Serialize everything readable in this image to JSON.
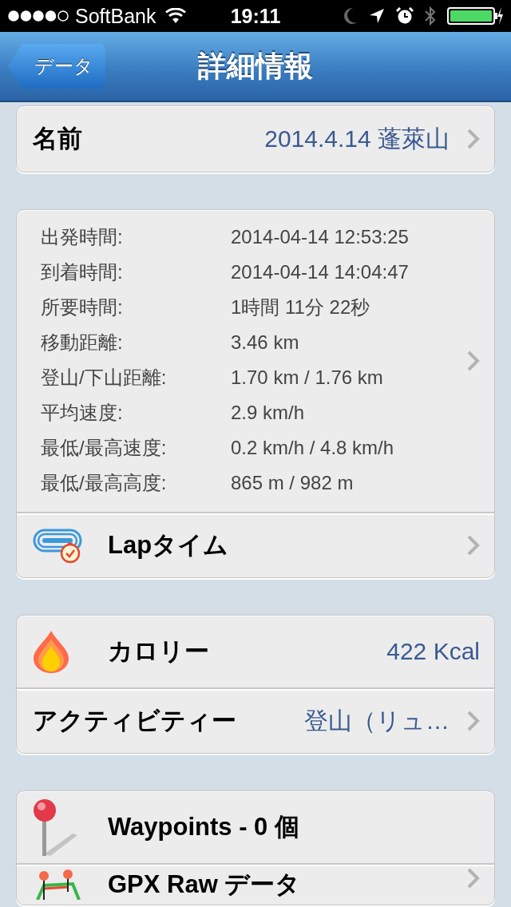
{
  "status_bar": {
    "carrier": "SoftBank",
    "time": "19:11"
  },
  "nav_bar": {
    "back_button": "データ",
    "title": "詳細情報"
  },
  "sections": [
    {
      "rows": [
        {
          "kind": "value",
          "label": "名前",
          "value": "2014.4.14 蓬萊山",
          "disclosure": true
        }
      ]
    },
    {
      "rows": [
        {
          "kind": "stats",
          "disclosure": true,
          "items": [
            {
              "label": "出発時間:",
              "value": "2014-04-14 12:53:25"
            },
            {
              "label": "到着時間:",
              "value": "2014-04-14 14:04:47"
            },
            {
              "label": "所要時間:",
              "value": "1時間 11分 22秒"
            },
            {
              "label": "移動距離:",
              "value": "3.46 km"
            },
            {
              "label": "登山/下山距離:",
              "value": "1.70 km / 1.76 km"
            },
            {
              "label": "平均速度:",
              "value": "2.9 km/h"
            },
            {
              "label": "最低/最高速度:",
              "value": "0.2 km/h / 4.8 km/h"
            },
            {
              "label": "最低/最高高度:",
              "value": "865 m / 982 m"
            }
          ]
        },
        {
          "kind": "lap",
          "label": "Lapタイム",
          "disclosure": true
        }
      ]
    },
    {
      "rows": [
        {
          "kind": "calorie",
          "label": "カロリー",
          "value": "422 Kcal",
          "disclosure": false
        },
        {
          "kind": "value",
          "label": "アクティビティー",
          "value": "登山（リュ…",
          "disclosure": true
        }
      ]
    },
    {
      "rows": [
        {
          "kind": "waypoint",
          "label": "Waypoints - 0 個",
          "disclosure": false
        },
        {
          "kind": "gpx",
          "label": "GPX Raw データ",
          "disclosure": true
        }
      ]
    }
  ]
}
